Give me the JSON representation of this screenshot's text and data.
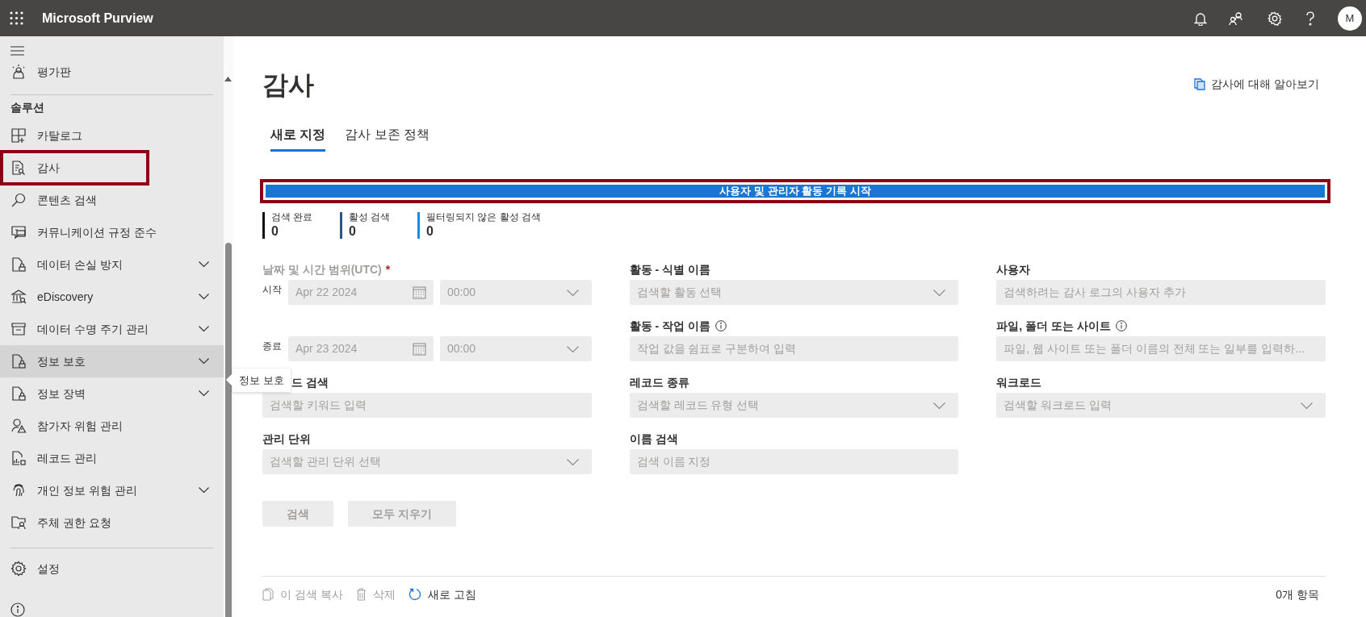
{
  "top_bar": {
    "app_title": "Microsoft Purview",
    "avatar": "M"
  },
  "sidebar": {
    "top_items": [
      {
        "label": "평가판",
        "expandable": false,
        "highlighted": false,
        "outlined": false
      }
    ],
    "section_heading": "솔루션",
    "solution_items": [
      {
        "label": "카탈로그",
        "expandable": false,
        "highlighted": false,
        "outlined": false
      },
      {
        "label": "감사",
        "expandable": false,
        "highlighted": false,
        "outlined": true
      },
      {
        "label": "콘텐츠 검색",
        "expandable": false,
        "highlighted": false,
        "outlined": false
      },
      {
        "label": "커뮤니케이션 규정 준수",
        "expandable": false,
        "highlighted": false,
        "outlined": false
      },
      {
        "label": "데이터 손실 방지",
        "expandable": true,
        "highlighted": false,
        "outlined": false
      },
      {
        "label": "eDiscovery",
        "expandable": true,
        "highlighted": false,
        "outlined": false
      },
      {
        "label": "데이터 수명 주기 관리",
        "expandable": true,
        "highlighted": false,
        "outlined": false
      },
      {
        "label": "정보 보호",
        "expandable": true,
        "highlighted": true,
        "outlined": false
      },
      {
        "label": "정보 장벽",
        "expandable": true,
        "highlighted": false,
        "outlined": false
      },
      {
        "label": "참가자 위험 관리",
        "expandable": false,
        "highlighted": false,
        "outlined": false
      },
      {
        "label": "레코드 관리",
        "expandable": false,
        "highlighted": false,
        "outlined": false
      },
      {
        "label": "개인 정보 위험 관리",
        "expandable": true,
        "highlighted": false,
        "outlined": false
      },
      {
        "label": "주체 권한 요청",
        "expandable": false,
        "highlighted": false,
        "outlined": false
      }
    ],
    "bottom_items": [
      {
        "label": "설정",
        "expandable": false,
        "highlighted": false,
        "outlined": false
      }
    ]
  },
  "tooltip": {
    "text": "정보 보호"
  },
  "page": {
    "title": "감사",
    "learn_link": "감사에 대해 알아보기",
    "tabs": [
      {
        "label": "새로 지정",
        "selected": true
      },
      {
        "label": "감사 보존 정책",
        "selected": false
      }
    ],
    "start_button": {
      "label": "사용자 및 관리자 활동 기록 시작",
      "outlined": true
    },
    "stats": [
      {
        "label": "검색 완료",
        "value": "0",
        "color": "#111111"
      },
      {
        "label": "활성 검색",
        "value": "0",
        "color": "#2f5383"
      },
      {
        "label": "필터링되지 않은 활성 검색",
        "value": "0",
        "color": "#1e88e5"
      }
    ],
    "columns": [
      [
        {
          "kind": "range",
          "label": "날짜 및 시간 범위(UTC)",
          "required_mark": "*",
          "disabled": true,
          "rows": [
            {
              "label": "시작",
              "date": "Apr 22 2024",
              "time": "00:00"
            },
            {
              "label": "종료",
              "date": "Apr 23 2024",
              "time": "00:00"
            }
          ]
        },
        {
          "kind": "input",
          "label": "드 검색",
          "covered": true,
          "placeholder": "검색할 키워드 입력"
        },
        {
          "kind": "dropdown",
          "label": "관리 단위",
          "placeholder": "검색할 관리 단위 선택"
        }
      ],
      [
        {
          "kind": "dropdown",
          "label": "활동 - 식별 이름",
          "placeholder": "검색할 활동 선택"
        },
        {
          "kind": "input",
          "label": "활동 - 작업 이름",
          "info": true,
          "placeholder": "작업 값을 쉼표로 구분하여 입력"
        },
        {
          "kind": "dropdown",
          "label": "레코드 종류",
          "placeholder": "검색할 레코드 유형 선택"
        },
        {
          "kind": "input",
          "label": "이름 검색",
          "placeholder": "검색 이름 지정"
        }
      ],
      [
        {
          "kind": "input",
          "label": "사용자",
          "placeholder": "검색하려는 감사 로그의 사용자 추가"
        },
        {
          "kind": "input",
          "label": "파일, 폴더 또는 사이트",
          "info": true,
          "placeholder": "파일, 웹 사이트 또는 폴더 이름의 전체 또는 일부를 입력하..."
        },
        {
          "kind": "dropdown",
          "label": "워크로드",
          "placeholder": "검색할 워크로드 입력"
        }
      ]
    ],
    "buttons": [
      {
        "label": "검색",
        "disabled": true
      },
      {
        "label": "모두 지우기",
        "disabled": true
      }
    ],
    "toolbar": {
      "actions": [
        {
          "kind": "copy",
          "label": "이 검색 복사",
          "disabled": true
        },
        {
          "kind": "delete",
          "label": "삭제",
          "disabled": true
        },
        {
          "kind": "refresh",
          "label": "새로 고침",
          "disabled": false
        }
      ],
      "count": "0개 항목"
    }
  }
}
